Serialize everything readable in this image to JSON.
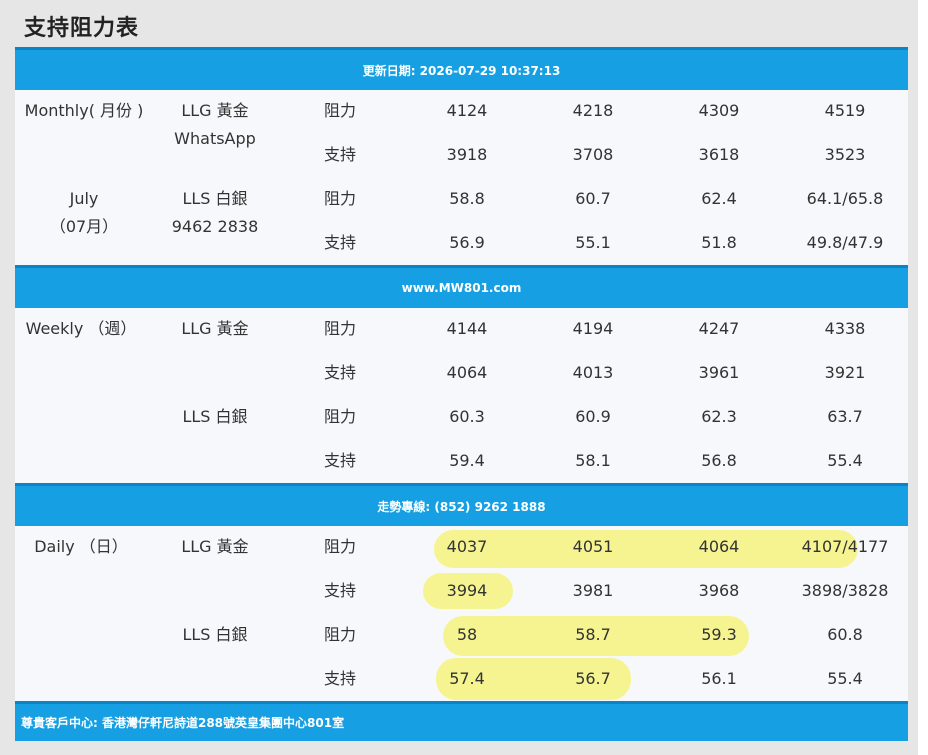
{
  "title": "支持阻力表",
  "bands": {
    "update": "更新日期: 2026-07-29 10:37:13",
    "website": "www.MW801.com",
    "hotline": "走勢專線: (852) 9262 1888",
    "address": "尊貴客戶中心: 香港灣仔軒尼詩道288號英皇集團中心801室"
  },
  "monthly": {
    "period_label": "Monthly( 月份 )",
    "month_label": "July",
    "month_cn": "（07月）",
    "gold_label": "LLG 黃金",
    "contact_label": "WhatsApp",
    "silver_label": "LLS 白銀",
    "contact_number": "9462 2838",
    "rows": [
      {
        "type": "阻力",
        "values": [
          "4124",
          "4218",
          "4309",
          "4519"
        ]
      },
      {
        "type": "支持",
        "values": [
          "3918",
          "3708",
          "3618",
          "3523"
        ]
      },
      {
        "type": "阻力",
        "values": [
          "58.8",
          "60.7",
          "62.4",
          "64.1/65.8"
        ]
      },
      {
        "type": "支持",
        "values": [
          "56.9",
          "55.1",
          "51.8",
          "49.8/47.9"
        ]
      }
    ]
  },
  "weekly": {
    "period_label": "Weekly （週）",
    "gold_label": "LLG 黃金",
    "silver_label": "LLS 白銀",
    "rows": [
      {
        "type": "阻力",
        "values": [
          "4144",
          "4194",
          "4247",
          "4338"
        ]
      },
      {
        "type": "支持",
        "values": [
          "4064",
          "4013",
          "3961",
          "3921"
        ]
      },
      {
        "type": "阻力",
        "values": [
          "60.3",
          "60.9",
          "62.3",
          "63.7"
        ]
      },
      {
        "type": "支持",
        "values": [
          "59.4",
          "58.1",
          "56.8",
          "55.4"
        ]
      }
    ]
  },
  "daily": {
    "period_label": "Daily （日）",
    "gold_label": "LLG 黃金",
    "silver_label": "LLS 白銀",
    "rows": [
      {
        "type": "阻力",
        "values": [
          "4037",
          "4051",
          "4064",
          "4107/4177"
        ]
      },
      {
        "type": "支持",
        "values": [
          "3994",
          "3981",
          "3968",
          "3898/3828"
        ]
      },
      {
        "type": "阻力",
        "values": [
          "58",
          "58.7",
          "59.3",
          "60.8"
        ]
      },
      {
        "type": "支持",
        "values": [
          "57.4",
          "56.7",
          "56.1",
          "55.4"
        ]
      }
    ]
  },
  "highlight_color": "#f6f37e"
}
